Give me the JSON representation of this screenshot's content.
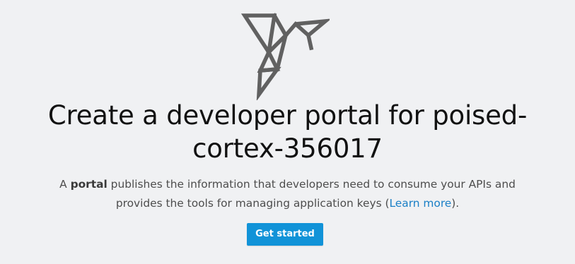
{
  "logo": {
    "icon": "origami-bird-icon",
    "color": "#616161"
  },
  "heading": {
    "line1": "Create a developer portal for poised-",
    "line2": "cortex-356017"
  },
  "description": {
    "prefix": "A ",
    "bold_word": "portal",
    "line1_rest": " publishes the information that developers need to consume your APIs and",
    "line2_start": "provides the tools for managing application keys (",
    "link_text": "Learn more",
    "line2_end": ")."
  },
  "cta": {
    "label": "Get started",
    "color": "#1193d8"
  },
  "colors": {
    "background": "#f0f1f3",
    "link": "#1a7fc6",
    "text": "#4d4d4d"
  }
}
